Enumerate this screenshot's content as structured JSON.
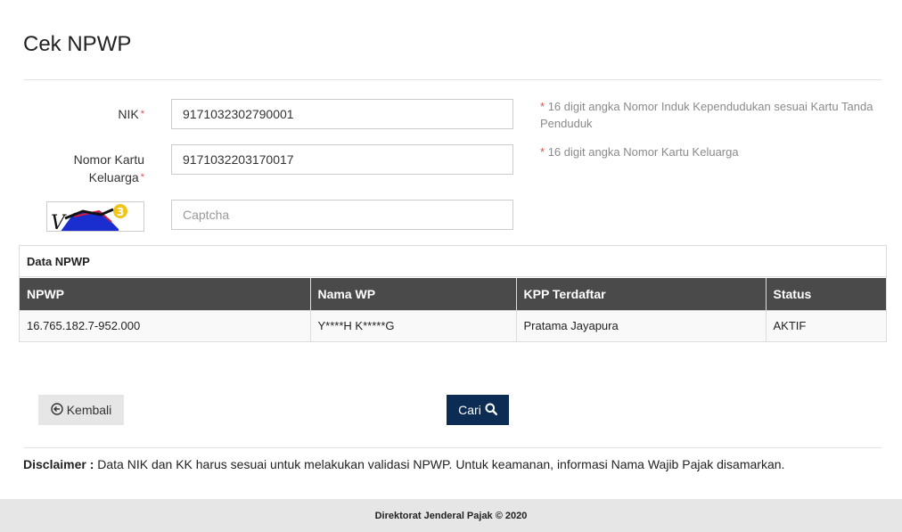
{
  "page": {
    "title": "Cek NPWP"
  },
  "form": {
    "nik": {
      "label": "NIK",
      "required_mark": "*",
      "value": "9171032302790001",
      "hint_star": "*",
      "hint": "16 digit angka Nomor Induk Kependudukan sesuai Kartu Tanda Penduduk"
    },
    "kk": {
      "label_line1": "Nomor Kartu",
      "label_line2": "Keluarga",
      "required_mark": "*",
      "value": "9171032203170017",
      "hint_star": "*",
      "hint": "16 digit angka Nomor Kartu Keluarga"
    },
    "captcha": {
      "image_text": "V",
      "placeholder": "Captcha"
    }
  },
  "result": {
    "heading": "Data NPWP",
    "columns": [
      "NPWP",
      "Nama WP",
      "KPP Terdaftar",
      "Status"
    ],
    "rows": [
      [
        "16.765.182.7-952.000",
        "Y****H K*****G",
        "Pratama Jayapura",
        "AKTIF"
      ]
    ]
  },
  "actions": {
    "back_label": "Kembali",
    "back_icon": "arrow-circle-left-icon",
    "search_label": "Cari",
    "search_icon": "search-icon",
    "search_color": "#0d2c54"
  },
  "disclaimer": {
    "label": "Disclaimer :",
    "text": "Data NIK dan KK harus sesuai untuk melakukan validasi NPWP. Untuk keamanan, informasi Nama Wajib Pajak disamarkan."
  },
  "footer": {
    "text": "Direktorat Jenderal Pajak © 2020"
  }
}
